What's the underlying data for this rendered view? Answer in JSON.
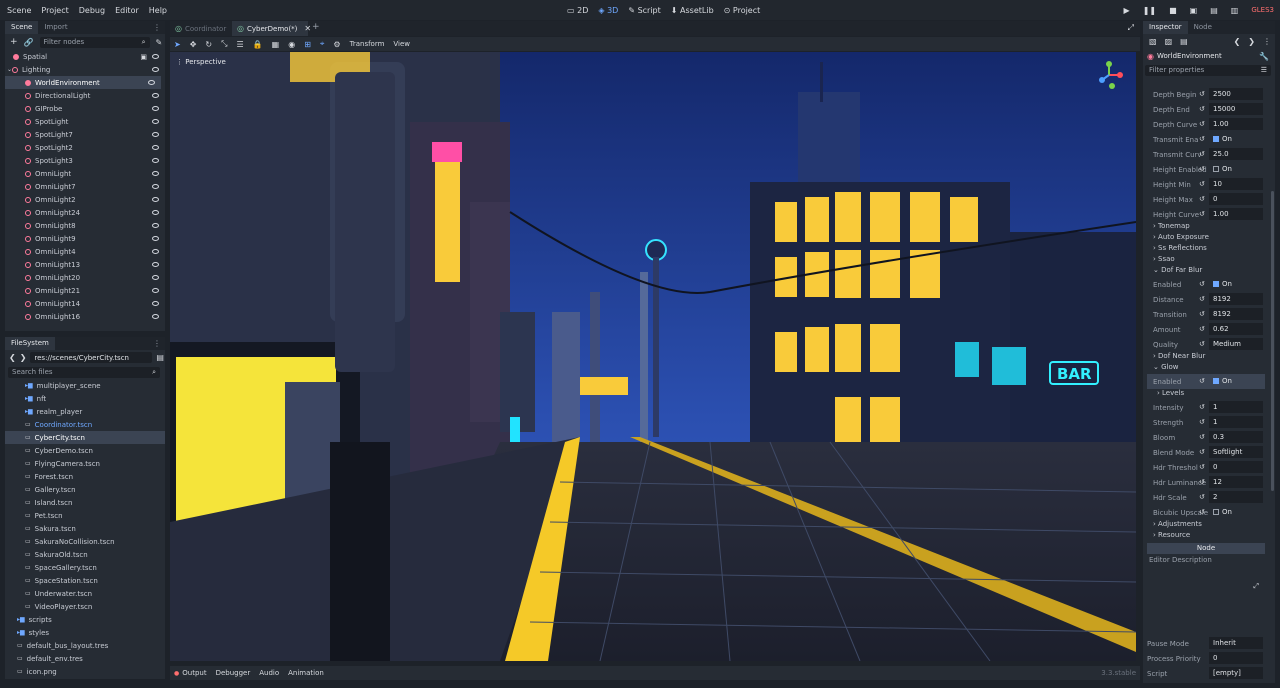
{
  "menu": [
    "Scene",
    "Project",
    "Debug",
    "Editor",
    "Help"
  ],
  "modes": [
    {
      "label": "2D",
      "active": false
    },
    {
      "label": "3D",
      "active": true
    },
    {
      "label": "Script",
      "active": false
    },
    {
      "label": "AssetLib",
      "active": false
    },
    {
      "label": "Project",
      "active": false
    }
  ],
  "renderer": "GLES3",
  "scene_panel": {
    "tabs": [
      "Scene",
      "Import"
    ],
    "filter_placeholder": "Filter nodes",
    "nodes": [
      "Spatial",
      "Lighting",
      "WorldEnvironment",
      "DirectionalLight",
      "GIProbe",
      "SpotLight",
      "SpotLight7",
      "SpotLight2",
      "SpotLight3",
      "OmniLight",
      "OmniLight7",
      "OmniLight2",
      "OmniLight24",
      "OmniLight8",
      "OmniLight9",
      "OmniLight4",
      "OmniLight13",
      "OmniLight20",
      "OmniLight21",
      "OmniLight14",
      "OmniLight16"
    ]
  },
  "filesystem": {
    "title": "FileSystem",
    "path": "res://scenes/CyberCity.tscn",
    "search_placeholder": "Search files",
    "items": [
      "multiplayer_scene",
      "nft",
      "realm_player",
      "Coordinator.tscn",
      "CyberCity.tscn",
      "CyberDemo.tscn",
      "FlyingCamera.tscn",
      "Forest.tscn",
      "Gallery.tscn",
      "Island.tscn",
      "Pet.tscn",
      "Sakura.tscn",
      "SakuraNoCollision.tscn",
      "SakuraOld.tscn",
      "SpaceGallery.tscn",
      "SpaceStation.tscn",
      "Underwater.tscn",
      "VideoPlayer.tscn",
      "scripts",
      "styles",
      "default_bus_layout.tres",
      "default_env.tres",
      "icon.png"
    ]
  },
  "editor_tabs": [
    "Coordinator",
    "CyberDemo(*)"
  ],
  "toolbar": {
    "transform": "Transform",
    "view": "View"
  },
  "viewport": {
    "perspective": "Perspective",
    "sign_text": "BAR"
  },
  "bottom": {
    "tabs": [
      "Output",
      "Debugger",
      "Audio",
      "Animation"
    ],
    "version": "3.3.stable"
  },
  "inspector": {
    "tabs": [
      "Inspector",
      "Node"
    ],
    "object": "WorldEnvironment",
    "filter_placeholder": "Filter properties",
    "props": [
      {
        "label": "Depth Begin",
        "value": "2500"
      },
      {
        "label": "Depth End",
        "value": "15000"
      },
      {
        "label": "Depth Curve",
        "value": "1.00"
      },
      {
        "label": "Transmit Ena",
        "value": "On"
      },
      {
        "label": "Transmit Curv",
        "value": "25.0"
      },
      {
        "label": "Height Enabled",
        "value": "On"
      },
      {
        "label": "Height Min",
        "value": "10"
      },
      {
        "label": "Height Max",
        "value": "0"
      },
      {
        "label": "Height Curve",
        "value": "1.00"
      }
    ],
    "sections": [
      "Tonemap",
      "Auto Exposure",
      "Ss Reflections",
      "Ssao",
      "Dof Far Blur"
    ],
    "dof": [
      {
        "label": "Enabled",
        "value": "On"
      },
      {
        "label": "Distance",
        "value": "8192"
      },
      {
        "label": "Transition",
        "value": "8192"
      },
      {
        "label": "Amount",
        "value": "0.62"
      },
      {
        "label": "Quality",
        "value": "Medium"
      }
    ],
    "sections2": [
      "Dof Near Blur",
      "Glow"
    ],
    "glow_enabled": {
      "label": "Enabled",
      "value": "On"
    },
    "levels": "Levels",
    "glow": [
      {
        "label": "Intensity",
        "value": "1"
      },
      {
        "label": "Strength",
        "value": "1"
      },
      {
        "label": "Bloom",
        "value": "0.3"
      },
      {
        "label": "Blend Mode",
        "value": "Softlight"
      },
      {
        "label": "Hdr Threshol",
        "value": "0"
      },
      {
        "label": "Hdr Luminance",
        "value": "12"
      },
      {
        "label": "Hdr Scale",
        "value": "2"
      },
      {
        "label": "Bicubic Upscale",
        "value": "On"
      }
    ],
    "sections3": [
      "Adjustments",
      "Resource"
    ],
    "node_button": "Node",
    "editor_description": "Editor Description",
    "bottom_props": [
      {
        "label": "Pause Mode",
        "value": "Inherit"
      },
      {
        "label": "Process Priority",
        "value": "0"
      },
      {
        "label": "Script",
        "value": "[empty]"
      }
    ]
  }
}
